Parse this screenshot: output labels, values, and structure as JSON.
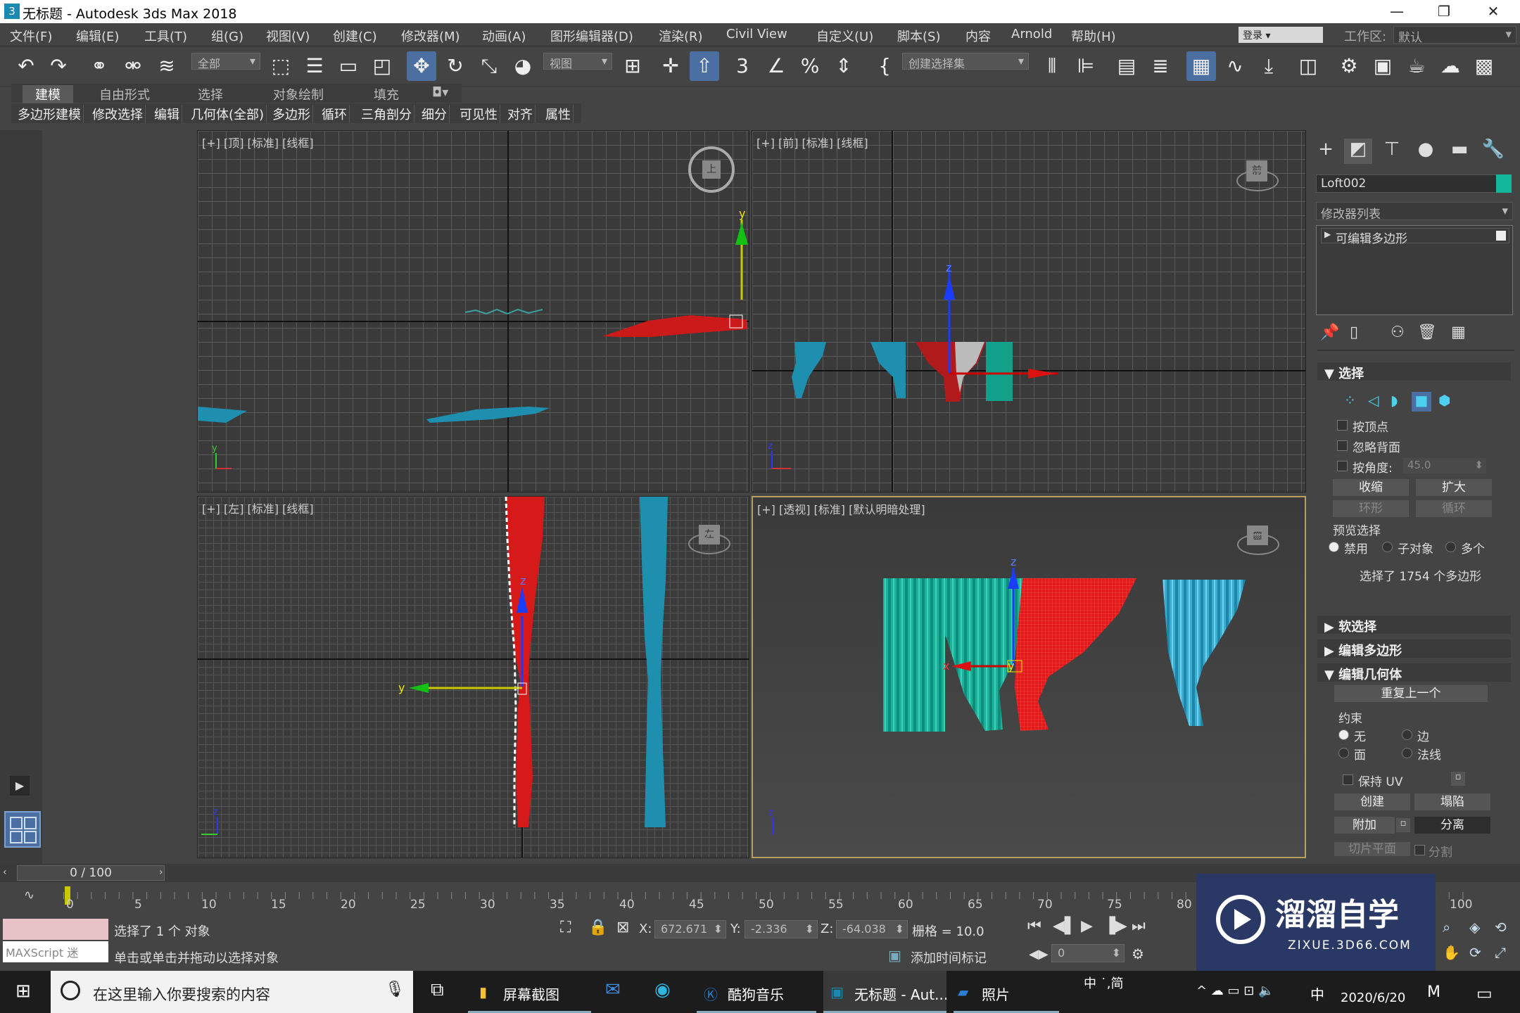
{
  "window": {
    "title": "无标题 - Autodesk 3ds Max 2018",
    "logo": "3",
    "controls": [
      "—",
      "❐",
      "✕"
    ]
  },
  "menubar": {
    "items": [
      "文件(F)",
      "编辑(E)",
      "工具(T)",
      "组(G)",
      "视图(V)",
      "创建(C)",
      "修改器(M)",
      "动画(A)",
      "图形编辑器(D)",
      "渲染(R)",
      "Civil View",
      "自定义(U)",
      "脚本(S)",
      "内容",
      "Arnold",
      "帮助(H)"
    ],
    "login": "登录",
    "workspace_label": "工作区:",
    "workspace_value": "默认"
  },
  "toolbar": {
    "filter_dropdown": "全部",
    "refcoord_dropdown": "视图",
    "selection_set_dropdown": "创建选择集"
  },
  "ribbon": {
    "tabs": [
      "建模",
      "自由形式",
      "选择",
      "对象绘制",
      "填充"
    ],
    "buttons": [
      "多边形建模",
      "修改选择",
      "编辑",
      "几何体(全部)",
      "多边形",
      "循环",
      "三角剖分",
      "细分",
      "可见性",
      "对齐",
      "属性"
    ]
  },
  "viewports": {
    "top": "[+] [顶] [标准] [线框]",
    "front": "[+] [前] [标准] [线框]",
    "left": "[+] [左] [标准] [线框]",
    "persp": "[+] [透视] [标准] [默认明暗处理]",
    "axis_x": "x",
    "axis_y": "y",
    "axis_z": "z",
    "cube_top": "上",
    "cube_front": "前",
    "cube_left": "左"
  },
  "command_panel": {
    "object_name": "Loft002",
    "object_color": "#12b89a",
    "modifier_list": "修改器列表",
    "stack_item": "可编辑多边形",
    "selection_header": "选择",
    "by_vertex": "按顶点",
    "ignore_backfacing": "忽略背面",
    "by_angle": "按角度:",
    "angle_value": "45.0",
    "shrink": "收缩",
    "grow": "扩大",
    "ring": "环形",
    "loop": "循环",
    "preview_selection": "预览选择",
    "preview_off": "禁用",
    "preview_subobj": "子对象",
    "preview_multi": "多个",
    "selected_info": "选择了 1754 个多边形",
    "soft_selection": "软选择",
    "edit_polygons": "编辑多边形",
    "edit_geometry": "编辑几何体",
    "repeat_last": "重复上一个",
    "constraints": "约束",
    "c_none": "无",
    "c_edge": "边",
    "c_face": "面",
    "c_normal": "法线",
    "preserve_uv": "保持 UV",
    "create": "创建",
    "collapse": "塌陷",
    "attach": "附加",
    "detach": "分离",
    "slice_plane": "切片平面",
    "split": "分割"
  },
  "timeline": {
    "slider_text": "0 / 100",
    "ticks": [
      "0",
      "5",
      "10",
      "15",
      "20",
      "25",
      "30",
      "35",
      "40",
      "45",
      "50",
      "55",
      "60",
      "65",
      "70",
      "75",
      "80",
      "85",
      "90",
      "95",
      "100"
    ]
  },
  "status": {
    "maxscript": "MAXScript 迷",
    "selected": "选择了 1 个 对象",
    "prompt": "单击或单击并拖动以选择对象",
    "x_label": "X:",
    "x_value": "672.671",
    "y_label": "Y:",
    "y_value": "-2.336",
    "z_label": "Z:",
    "z_value": "-64.038",
    "grid": "栅格 = 10.0",
    "add_time_tag": "添加时间标记",
    "frame_value": "0"
  },
  "watermark": {
    "title": "溜溜自学",
    "url": "ZIXUE.3D66.COM"
  },
  "taskbar": {
    "search_placeholder": "在这里输入你要搜索的内容",
    "apps": [
      "屏幕截图",
      "酷狗音乐",
      "无标题 - Aut...",
      "照片"
    ],
    "ime": "中 ˙,简",
    "ime2": "中",
    "date": "2020/6/20"
  }
}
